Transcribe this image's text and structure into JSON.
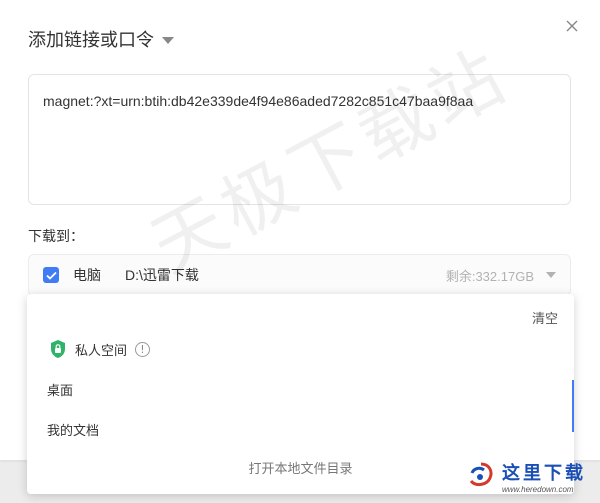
{
  "dialog": {
    "title": "添加链接或口令",
    "close_icon": "close-icon"
  },
  "link_input": {
    "value": "magnet:?xt=urn:btih:db42e339de4f94e86aded7282c851c47baa9f8aa"
  },
  "download": {
    "label": "下载到：",
    "device": "电脑",
    "path": "D:\\迅雷下载",
    "free_space": "剩余:332.17GB",
    "checked": true
  },
  "dropdown": {
    "clear_label": "清空",
    "private_space_label": "私人空间",
    "items": [
      "桌面",
      "我的文档"
    ],
    "open_local_label": "打开本地文件目录"
  },
  "watermark": {
    "text": "天极下载站"
  },
  "corner_logo": {
    "cn": "这里下载",
    "url": "www.heredown.com"
  },
  "colors": {
    "accent": "#3f7cf5",
    "shield": "#2fb36a",
    "muted": "#b2b2b2"
  }
}
